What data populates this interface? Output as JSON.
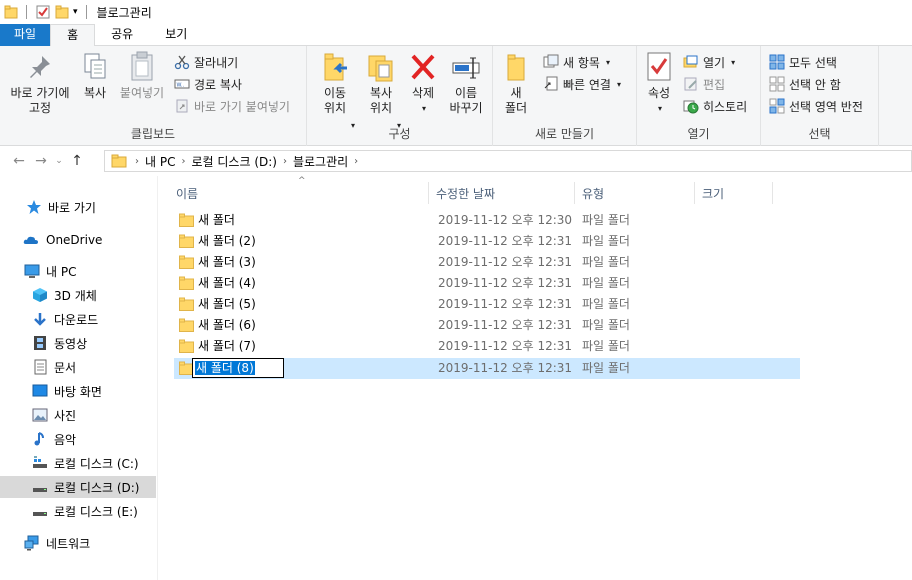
{
  "window": {
    "title": "블로그관리"
  },
  "tabs": [
    "파일",
    "홈",
    "공유",
    "보기"
  ],
  "ribbon": {
    "clipboard": {
      "label": "클립보드",
      "pin": "바로 가기에\n고정",
      "copy": "복사",
      "paste": "붙여넣기",
      "cut": "잘라내기",
      "copy_path": "경로 복사",
      "paste_shortcut": "바로 가기 붙여넣기"
    },
    "organize": {
      "label": "구성",
      "move_to": "이동\n위치",
      "copy_to": "복사\n위치",
      "delete": "삭제",
      "rename": "이름\n바꾸기"
    },
    "new": {
      "label": "새로 만들기",
      "new_folder": "새\n폴더",
      "new_item": "새 항목",
      "easy_access": "빠른 연결"
    },
    "open": {
      "label": "열기",
      "properties": "속성",
      "open": "열기",
      "edit": "편집",
      "history": "히스토리"
    },
    "select": {
      "label": "선택",
      "select_all": "모두 선택",
      "select_none": "선택 안 함",
      "invert": "선택 영역 반전"
    }
  },
  "address": {
    "crumbs": [
      "내 PC",
      "로컬 디스크 (D:)",
      "블로그관리"
    ]
  },
  "sidebar": {
    "items": [
      {
        "label": "바로 가기",
        "icon": "star-icon"
      },
      {
        "label": "OneDrive",
        "icon": "cloud-icon"
      },
      {
        "label": "내 PC",
        "icon": "computer-icon"
      },
      {
        "label": "3D 개체",
        "icon": "cube-icon"
      },
      {
        "label": "다운로드",
        "icon": "download-icon"
      },
      {
        "label": "동영상",
        "icon": "film-icon"
      },
      {
        "label": "문서",
        "icon": "document-icon"
      },
      {
        "label": "바탕 화면",
        "icon": "desktop-icon"
      },
      {
        "label": "사진",
        "icon": "picture-icon"
      },
      {
        "label": "음악",
        "icon": "music-icon"
      },
      {
        "label": "로컬 디스크 (C:)",
        "icon": "drive-icon"
      },
      {
        "label": "로컬 디스크 (D:)",
        "icon": "drive-icon"
      },
      {
        "label": "로컬 디스크 (E:)",
        "icon": "drive-icon"
      },
      {
        "label": "네트워크",
        "icon": "network-icon"
      }
    ]
  },
  "columns": {
    "name": "이름",
    "date": "수정한 날짜",
    "type": "유형",
    "size": "크기"
  },
  "files": [
    {
      "name": "새 폴더",
      "date": "2019-11-12 오후 12:30",
      "type": "파일 폴더"
    },
    {
      "name": "새 폴더 (2)",
      "date": "2019-11-12 오후 12:31",
      "type": "파일 폴더"
    },
    {
      "name": "새 폴더 (3)",
      "date": "2019-11-12 오후 12:31",
      "type": "파일 폴더"
    },
    {
      "name": "새 폴더 (4)",
      "date": "2019-11-12 오후 12:31",
      "type": "파일 폴더"
    },
    {
      "name": "새 폴더 (5)",
      "date": "2019-11-12 오후 12:31",
      "type": "파일 폴더"
    },
    {
      "name": "새 폴더 (6)",
      "date": "2019-11-12 오후 12:31",
      "type": "파일 폴더"
    },
    {
      "name": "새 폴더 (7)",
      "date": "2019-11-12 오후 12:31",
      "type": "파일 폴더"
    },
    {
      "name": "새 폴더 (8)",
      "date": "2019-11-12 오후 12:31",
      "type": "파일 폴더"
    }
  ],
  "colors": {
    "file_tab": "#1979ca",
    "selection": "#cce8ff",
    "folder": "#ffd768"
  }
}
